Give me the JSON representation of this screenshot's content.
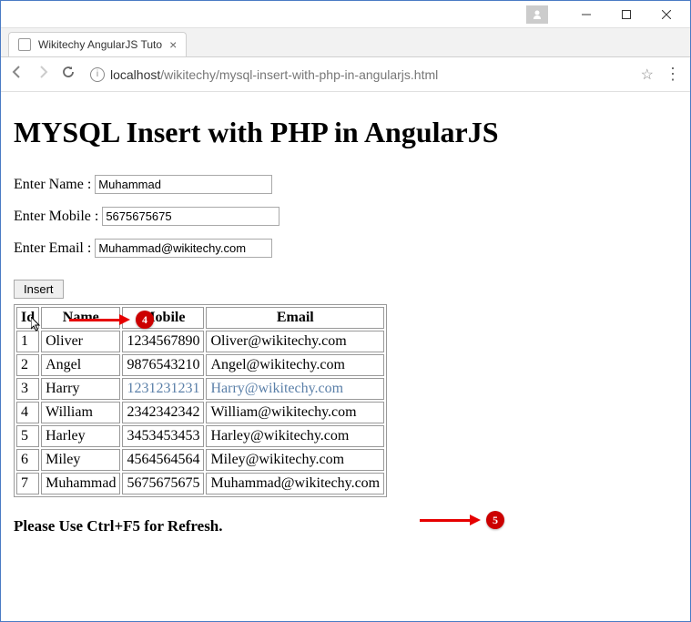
{
  "window": {
    "tab_title": "Wikitechy AngularJS Tuto",
    "url_host": "localhost",
    "url_path": "/wikitechy/mysql-insert-with-php-in-angularjs.html"
  },
  "page": {
    "heading": "MYSQL Insert with PHP in AngularJS",
    "labels": {
      "name": "Enter Name : ",
      "mobile": "Enter Mobile : ",
      "email": "Enter Email : "
    },
    "inputs": {
      "name": "Muhammad",
      "mobile": "5675675675",
      "email": "Muhammad@wikitechy.com"
    },
    "insert_btn": "Insert",
    "refresh_msg": "Please Use Ctrl+F5 for Refresh."
  },
  "table": {
    "headers": {
      "id": "Id",
      "name": "Name",
      "mobile": "Mobile",
      "email": "Email"
    },
    "rows": [
      {
        "id": "1",
        "name": "Oliver",
        "mobile": "1234567890",
        "email": "Oliver@wikitechy.com"
      },
      {
        "id": "2",
        "name": "Angel",
        "mobile": "9876543210",
        "email": "Angel@wikitechy.com"
      },
      {
        "id": "3",
        "name": "Harry",
        "mobile": "1231231231",
        "email": "Harry@wikitechy.com"
      },
      {
        "id": "4",
        "name": "William",
        "mobile": "2342342342",
        "email": "William@wikitechy.com"
      },
      {
        "id": "5",
        "name": "Harley",
        "mobile": "3453453453",
        "email": "Harley@wikitechy.com"
      },
      {
        "id": "6",
        "name": "Miley",
        "mobile": "4564564564",
        "email": "Miley@wikitechy.com"
      },
      {
        "id": "7",
        "name": "Muhammad",
        "mobile": "5675675675",
        "email": "Muhammad@wikitechy.com"
      }
    ]
  },
  "annotations": {
    "badge4": "4",
    "badge5": "5"
  }
}
